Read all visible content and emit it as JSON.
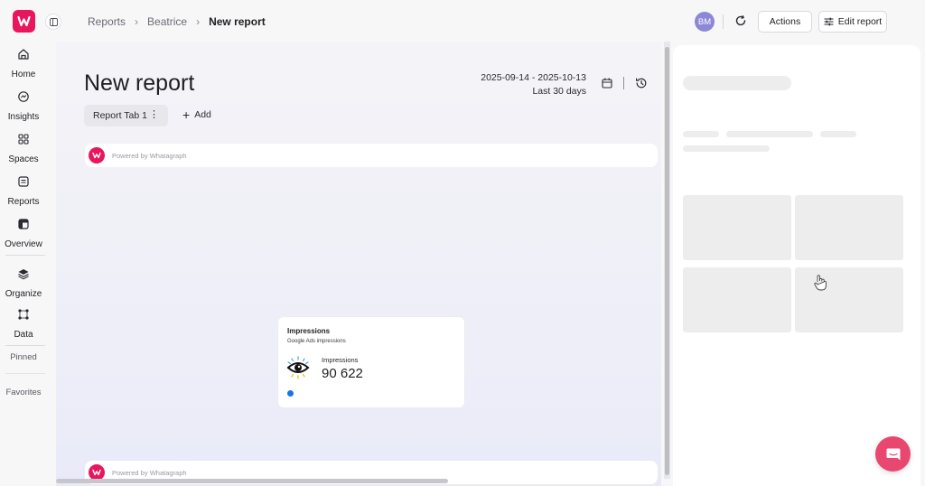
{
  "nav": {
    "items": [
      {
        "label": "Home",
        "icon": "home-icon"
      },
      {
        "label": "Insights",
        "icon": "insights-icon"
      },
      {
        "label": "Spaces",
        "icon": "spaces-icon"
      },
      {
        "label": "Reports",
        "icon": "reports-icon"
      },
      {
        "label": "Overview",
        "icon": "overview-icon"
      },
      {
        "label": "Organize",
        "icon": "layers-icon"
      },
      {
        "label": "Data",
        "icon": "data-icon"
      }
    ],
    "pinned": "Pinned",
    "favorites": "Favorites"
  },
  "breadcrumb": [
    "Reports",
    "Beatrice",
    "New report"
  ],
  "header": {
    "avatar_initials": "BM",
    "actions_label": "Actions",
    "edit_label": "Edit report"
  },
  "report": {
    "title": "New report",
    "date_range": "2025-09-14 - 2025-10-13",
    "date_preset": "Last 30 days",
    "tabs": [
      {
        "label": "Report Tab 1"
      }
    ],
    "add_tab_label": "Add",
    "powered_by": "Powered by Whatagraph"
  },
  "widget": {
    "title": "Impressions",
    "subtitle": "Google Ads impressions",
    "metric_label": "Impressions",
    "metric_value": "90 622"
  },
  "colors": {
    "brand": "#e8175d",
    "avatar": "#8d87d8",
    "chat": "#e8476f"
  }
}
